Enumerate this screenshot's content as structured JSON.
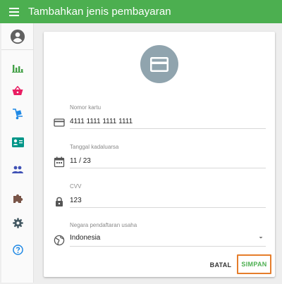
{
  "app": {
    "title": "Tambahkan jenis pembayaran"
  },
  "colors": {
    "primary": "#4caf50",
    "avatar_bg": "#90a4ae",
    "highlight": "#e57d2b"
  },
  "sidebar": {
    "items": [
      {
        "name": "charts-icon",
        "color": "#43a047"
      },
      {
        "name": "basket-icon",
        "color": "#e91e63"
      },
      {
        "name": "hand-truck-icon",
        "color": "#1e88e5"
      },
      {
        "name": "contact-card-icon",
        "color": "#009688"
      },
      {
        "name": "people-icon",
        "color": "#3f51b5"
      },
      {
        "name": "puzzle-icon",
        "color": "#795548"
      },
      {
        "name": "settings-icon",
        "color": "#455a64"
      },
      {
        "name": "help-icon",
        "color": "#1e88e5"
      }
    ]
  },
  "form": {
    "card_number": {
      "label": "Nomor kartu",
      "value": "4111 1111 1111 1111"
    },
    "expiry": {
      "label": "Tanggal kadaluarsa",
      "value": "11 / 23"
    },
    "cvv": {
      "label": "CVV",
      "value": "123"
    },
    "country": {
      "label": "Negara pendaftaran usaha",
      "value": "Indonesia"
    }
  },
  "actions": {
    "cancel": "BATAL",
    "save": "SIMPAN"
  }
}
